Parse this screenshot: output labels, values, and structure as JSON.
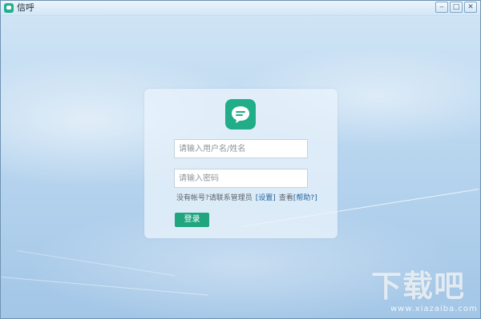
{
  "window": {
    "title": "信呼",
    "icon": "chat-bubble-icon",
    "controls": {
      "minimize": "‒",
      "maximize": "□",
      "close": "✕"
    }
  },
  "login": {
    "logo_icon": "chat-bubble-icon",
    "username_placeholder": "请输入用户名/姓名",
    "password_placeholder": "请输入密码",
    "helper": {
      "no_account_text": "没有帐号?请联系管理员",
      "settings_link": "[设置]",
      "view_text": "查看",
      "help_link": "[帮助?]"
    },
    "login_button": "登录"
  },
  "watermark": {
    "main": "下载吧",
    "sub": "www.xiazaiba.com"
  },
  "colors": {
    "accent": "#20a580",
    "logo_bg": "#20ad87",
    "link": "#1f5f9a",
    "background_top": "#d2e6f6",
    "background_bottom": "#a3c6e7"
  }
}
